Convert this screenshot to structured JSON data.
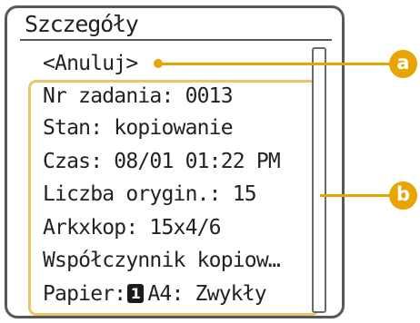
{
  "screen": {
    "title": "Szczegóły",
    "cancel_label": "<Anuluj>",
    "details": {
      "job_number": "Nr zadania: 0013",
      "status": "Stan: kopiowanie",
      "time": "Czas: 08/01 01:22 PM",
      "originals": "Liczba orygin.: 15",
      "sheets_copies": "Arkxkop: 15x4/6",
      "ratio": "Współczynnik kopiow…",
      "paper_label": "Papier:",
      "paper_tray": "1",
      "paper_value": "A4: Zwykły"
    }
  },
  "callouts": {
    "a": "a",
    "b": "b"
  },
  "colors": {
    "callout": "#e8a400",
    "highlight_box": "#e8c76c",
    "frame": "#585858"
  }
}
